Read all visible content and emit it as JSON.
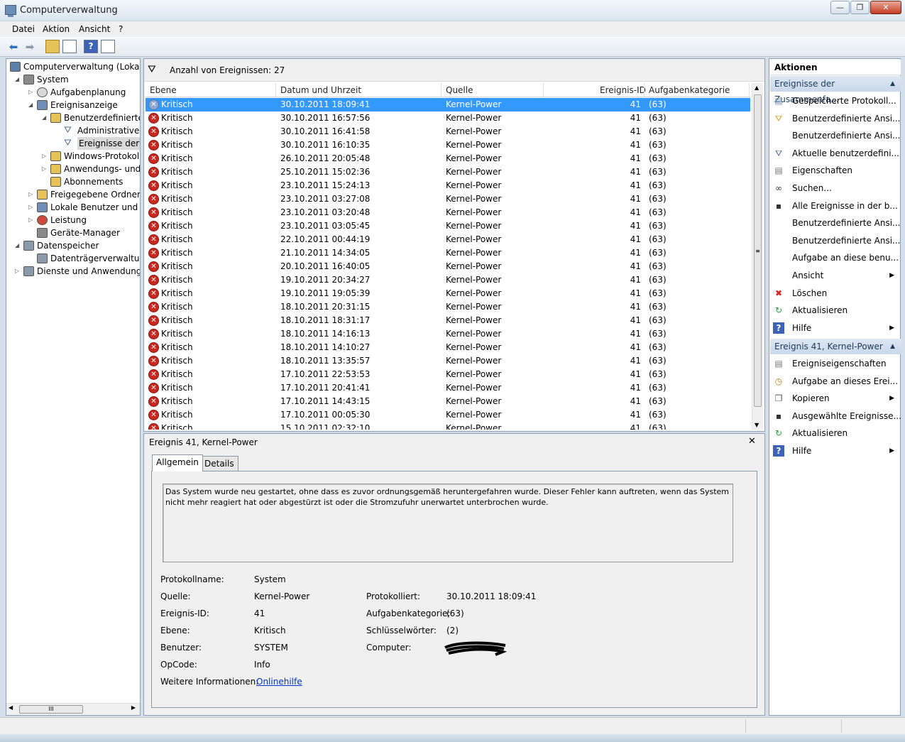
{
  "window": {
    "title": "Computerverwaltung",
    "min": "—",
    "max": "❐",
    "close": "✕"
  },
  "menu": [
    "Datei",
    "Aktion",
    "Ansicht",
    "?"
  ],
  "tree": [
    {
      "label": "Computerverwaltung (Lokal)",
      "level": 0,
      "exp": "",
      "icon": "computer-icon"
    },
    {
      "label": "System",
      "level": 1,
      "exp": "◢",
      "icon": "system-tools-icon"
    },
    {
      "label": "Aufgabenplanung",
      "level": 2,
      "exp": "▷",
      "icon": "clock-icon"
    },
    {
      "label": "Ereignisanzeige",
      "level": 2,
      "exp": "◢",
      "icon": "event-viewer-icon"
    },
    {
      "label": "Benutzerdefinierte A",
      "level": 3,
      "exp": "◢",
      "icon": "folder-icon"
    },
    {
      "label": "Administrative E",
      "level": 4,
      "exp": "",
      "icon": "filter-icon"
    },
    {
      "label": "Ereignisse der Zu",
      "level": 4,
      "exp": "",
      "icon": "filter-icon",
      "selected": true
    },
    {
      "label": "Windows-Protokolle",
      "level": 3,
      "exp": "▷",
      "icon": "folder-icon"
    },
    {
      "label": "Anwendungs- und D",
      "level": 3,
      "exp": "▷",
      "icon": "folder-icon"
    },
    {
      "label": "Abonnements",
      "level": 3,
      "exp": "",
      "icon": "subscription-icon"
    },
    {
      "label": "Freigegebene Ordner",
      "level": 2,
      "exp": "▷",
      "icon": "shared-folder-icon"
    },
    {
      "label": "Lokale Benutzer und Gru",
      "level": 2,
      "exp": "▷",
      "icon": "users-icon"
    },
    {
      "label": "Leistung",
      "level": 2,
      "exp": "▷",
      "icon": "performance-icon"
    },
    {
      "label": "Geräte-Manager",
      "level": 2,
      "exp": "",
      "icon": "device-manager-icon"
    },
    {
      "label": "Datenspeicher",
      "level": 1,
      "exp": "◢",
      "icon": "storage-icon"
    },
    {
      "label": "Datenträgerverwaltung",
      "level": 2,
      "exp": "",
      "icon": "disk-icon"
    },
    {
      "label": "Dienste und Anwendungen",
      "level": 1,
      "exp": "▷",
      "icon": "services-icon"
    }
  ],
  "scroll": {
    "hthumb": "III"
  },
  "events": {
    "count_label": "Anzahl von Ereignissen: 27",
    "columns": [
      "Ebene",
      "Datum und Uhrzeit",
      "Quelle",
      "Ereignis-ID",
      "Aufgabenkategorie"
    ],
    "rows": [
      [
        "Kritisch",
        "30.10.2011 18:09:41",
        "Kernel-Power",
        "41",
        "(63)"
      ],
      [
        "Kritisch",
        "30.10.2011 16:57:56",
        "Kernel-Power",
        "41",
        "(63)"
      ],
      [
        "Kritisch",
        "30.10.2011 16:41:58",
        "Kernel-Power",
        "41",
        "(63)"
      ],
      [
        "Kritisch",
        "30.10.2011 16:10:35",
        "Kernel-Power",
        "41",
        "(63)"
      ],
      [
        "Kritisch",
        "26.10.2011 20:05:48",
        "Kernel-Power",
        "41",
        "(63)"
      ],
      [
        "Kritisch",
        "25.10.2011 15:02:36",
        "Kernel-Power",
        "41",
        "(63)"
      ],
      [
        "Kritisch",
        "23.10.2011 15:24:13",
        "Kernel-Power",
        "41",
        "(63)"
      ],
      [
        "Kritisch",
        "23.10.2011 03:27:08",
        "Kernel-Power",
        "41",
        "(63)"
      ],
      [
        "Kritisch",
        "23.10.2011 03:20:48",
        "Kernel-Power",
        "41",
        "(63)"
      ],
      [
        "Kritisch",
        "23.10.2011 03:05:45",
        "Kernel-Power",
        "41",
        "(63)"
      ],
      [
        "Kritisch",
        "22.10.2011 00:44:19",
        "Kernel-Power",
        "41",
        "(63)"
      ],
      [
        "Kritisch",
        "21.10.2011 14:34:05",
        "Kernel-Power",
        "41",
        "(63)"
      ],
      [
        "Kritisch",
        "20.10.2011 16:40:05",
        "Kernel-Power",
        "41",
        "(63)"
      ],
      [
        "Kritisch",
        "19.10.2011 20:34:27",
        "Kernel-Power",
        "41",
        "(63)"
      ],
      [
        "Kritisch",
        "19.10.2011 19:05:39",
        "Kernel-Power",
        "41",
        "(63)"
      ],
      [
        "Kritisch",
        "18.10.2011 20:31:15",
        "Kernel-Power",
        "41",
        "(63)"
      ],
      [
        "Kritisch",
        "18.10.2011 18:31:17",
        "Kernel-Power",
        "41",
        "(63)"
      ],
      [
        "Kritisch",
        "18.10.2011 14:16:13",
        "Kernel-Power",
        "41",
        "(63)"
      ],
      [
        "Kritisch",
        "18.10.2011 14:10:27",
        "Kernel-Power",
        "41",
        "(63)"
      ],
      [
        "Kritisch",
        "18.10.2011 13:35:57",
        "Kernel-Power",
        "41",
        "(63)"
      ],
      [
        "Kritisch",
        "17.10.2011 22:53:53",
        "Kernel-Power",
        "41",
        "(63)"
      ],
      [
        "Kritisch",
        "17.10.2011 20:41:41",
        "Kernel-Power",
        "41",
        "(63)"
      ],
      [
        "Kritisch",
        "17.10.2011 14:43:15",
        "Kernel-Power",
        "41",
        "(63)"
      ],
      [
        "Kritisch",
        "17.10.2011 00:05:30",
        "Kernel-Power",
        "41",
        "(63)"
      ],
      [
        "Kritisch",
        "15.10.2011 02:32:10",
        "Kernel-Power",
        "41",
        "(63)"
      ]
    ]
  },
  "detail": {
    "title": "Ereignis 41, Kernel-Power",
    "close": "✕",
    "tabs": [
      "Allgemein",
      "Details"
    ],
    "description": "Das System wurde neu gestartet, ohne dass es zuvor ordnungsgemäß heruntergefahren wurde. Dieser Fehler kann auftreten, wenn das System nicht mehr reagiert hat oder abgestürzt ist oder die Stromzufuhr unerwartet unterbrochen wurde.",
    "fields": {
      "protokollname_label": "Protokollname:",
      "protokollname": "System",
      "quelle_label": "Quelle:",
      "quelle": "Kernel-Power",
      "protokolliert_label": "Protokolliert:",
      "protokolliert": "30.10.2011 18:09:41",
      "id_label": "Ereignis-ID:",
      "id": "41",
      "kategorie_label": "Aufgabenkategorie:",
      "kategorie": "(63)",
      "ebene_label": "Ebene:",
      "ebene": "Kritisch",
      "schluessel_label": "Schlüsselwörter:",
      "schluessel": "(2)",
      "benutzer_label": "Benutzer:",
      "benutzer": "SYSTEM",
      "computer_label": "Computer:",
      "opcode_label": "OpCode:",
      "opcode": "Info",
      "weitere_label": "Weitere Informationen:",
      "weitere": "Onlinehilfe"
    }
  },
  "actions": {
    "header": "Aktionen",
    "group1": "Ereignisse der Zusammenfa...",
    "items1": [
      {
        "label": "Gespeicherte Protokoll...",
        "icon": "open-log-icon"
      },
      {
        "label": "Benutzerdefinierte Ansi...",
        "icon": "create-view-icon"
      },
      {
        "label": "Benutzerdefinierte Ansi...",
        "icon": ""
      },
      {
        "label": "Aktuelle benutzerdefini...",
        "icon": "filter-icon"
      },
      {
        "label": "Eigenschaften",
        "icon": "properties-icon"
      },
      {
        "label": "Suchen...",
        "icon": "binoculars-icon"
      },
      {
        "label": "Alle Ereignisse in der b...",
        "icon": "save-icon"
      },
      {
        "label": "Benutzerdefinierte Ansi...",
        "icon": ""
      },
      {
        "label": "Benutzerdefinierte Ansi...",
        "icon": ""
      },
      {
        "label": "Aufgabe an diese benu...",
        "icon": ""
      },
      {
        "label": "Ansicht",
        "icon": "",
        "submenu": true
      },
      {
        "label": "Löschen",
        "icon": "delete-icon"
      },
      {
        "label": "Aktualisieren",
        "icon": "refresh-icon"
      },
      {
        "label": "Hilfe",
        "icon": "help-icon",
        "submenu": true
      }
    ],
    "group2": "Ereignis 41, Kernel-Power",
    "items2": [
      {
        "label": "Ereigniseigenschaften",
        "icon": "event-properties-icon"
      },
      {
        "label": "Aufgabe an dieses Erei...",
        "icon": "attach-task-icon"
      },
      {
        "label": "Kopieren",
        "icon": "copy-icon",
        "submenu": true
      },
      {
        "label": "Ausgewählte Ereignisse...",
        "icon": "save-icon"
      },
      {
        "label": "Aktualisieren",
        "icon": "refresh-icon"
      },
      {
        "label": "Hilfe",
        "icon": "help-icon",
        "submenu": true
      }
    ]
  },
  "colors": {
    "selection": "#3399ff",
    "critical": "#c8281d",
    "group_header": "#c8d7ea",
    "link": "#0033cc"
  }
}
